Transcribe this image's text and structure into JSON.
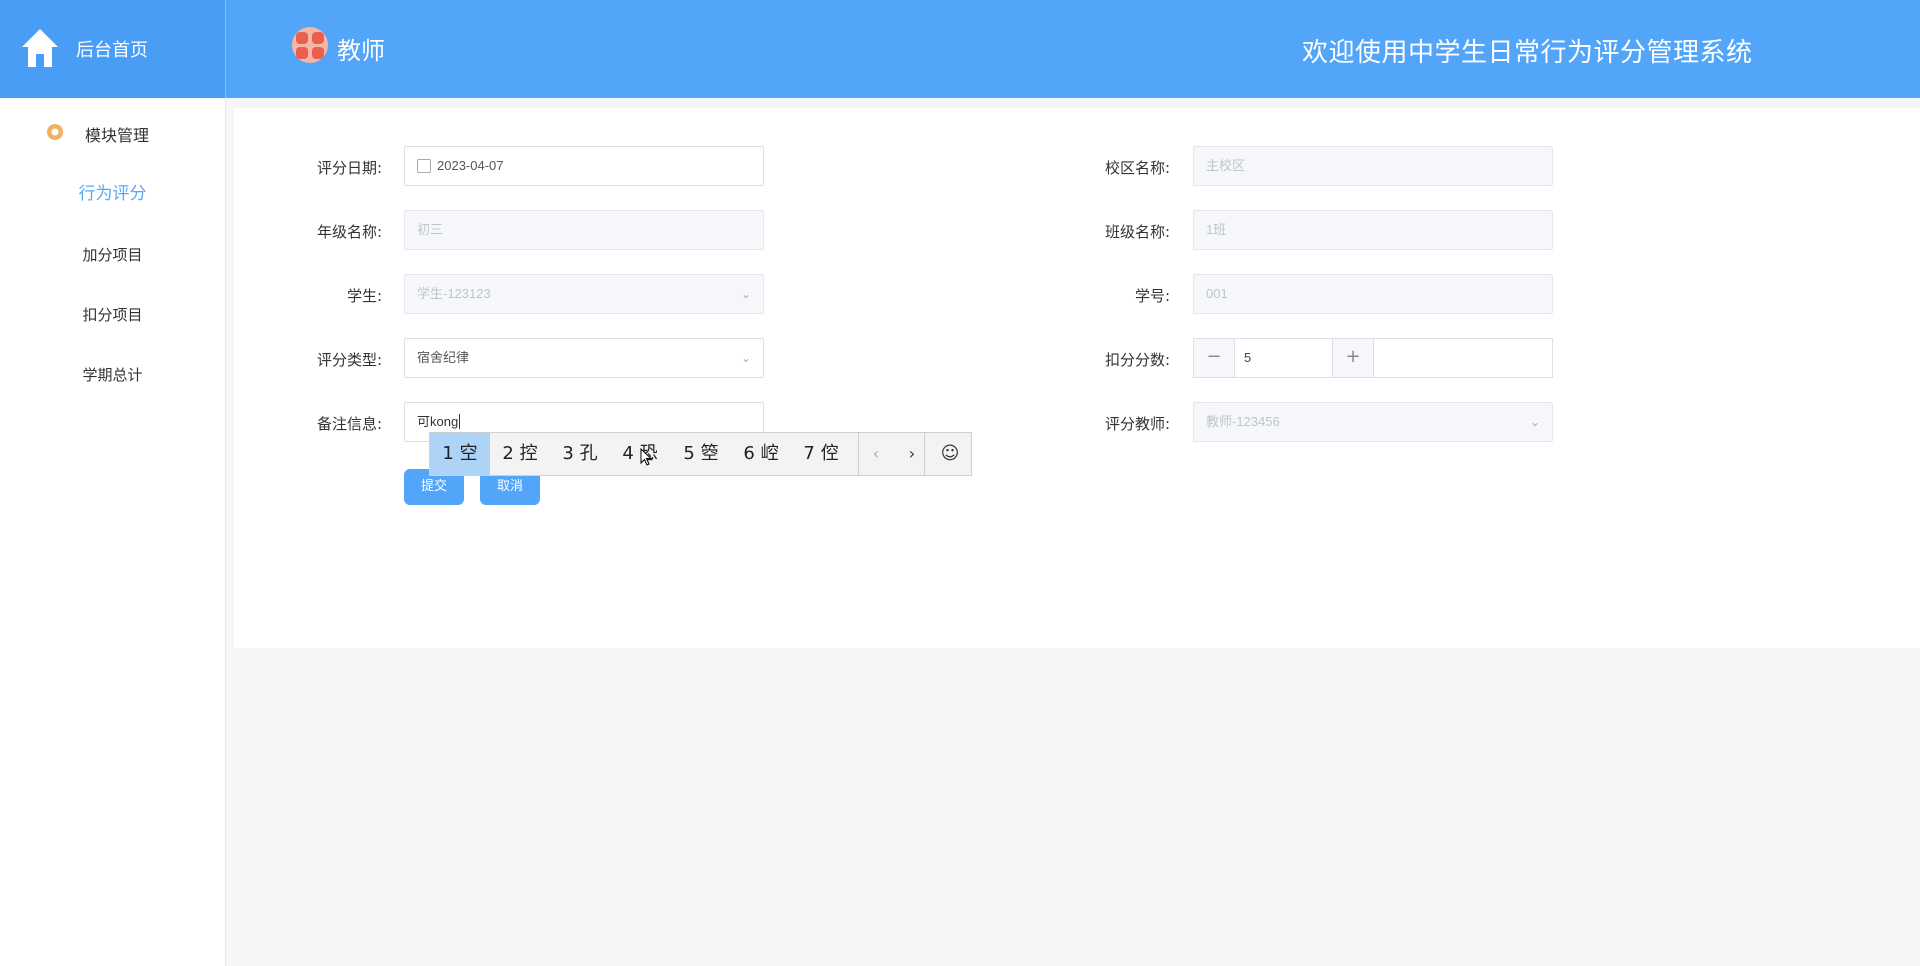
{
  "header": {
    "home_label": "后台首页",
    "user_name": "教师",
    "site_title": "欢迎使用中学生日常行为评分管理系统",
    "bg_color": "#52a5f8"
  },
  "sidebar": {
    "group_label": "模块管理",
    "items": [
      {
        "label": "行为评分",
        "active": true
      },
      {
        "label": "加分项目",
        "active": false
      },
      {
        "label": "扣分项目",
        "active": false
      },
      {
        "label": "学期总计",
        "active": false
      }
    ]
  },
  "form": {
    "score_date": {
      "label": "评分日期:",
      "value": "2023-04-07"
    },
    "campus": {
      "label": "校区名称:",
      "value": "主校区"
    },
    "grade": {
      "label": "年级名称:",
      "value": "初三"
    },
    "class": {
      "label": "班级名称:",
      "value": "1班"
    },
    "student": {
      "label": "学生:",
      "value": "学生-123123"
    },
    "student_no": {
      "label": "学号:",
      "value": "001"
    },
    "score_type": {
      "label": "评分类型:",
      "value": "宿舍纪律"
    },
    "deduct": {
      "label": "扣分分数:",
      "value": "5",
      "minus": "−",
      "plus": "+"
    },
    "remark": {
      "label": "备注信息:",
      "value": "可kong"
    },
    "teacher": {
      "label": "评分教师:",
      "value": "教师-123456"
    },
    "submit_label": "提交",
    "cancel_label": "取消"
  },
  "ime": {
    "candidates": [
      "1 空",
      "2 控",
      "3 孔",
      "4 恐",
      "5 箜",
      "6 崆",
      "7 倥"
    ],
    "prev": "‹",
    "next": "›",
    "emoji": "☺"
  }
}
